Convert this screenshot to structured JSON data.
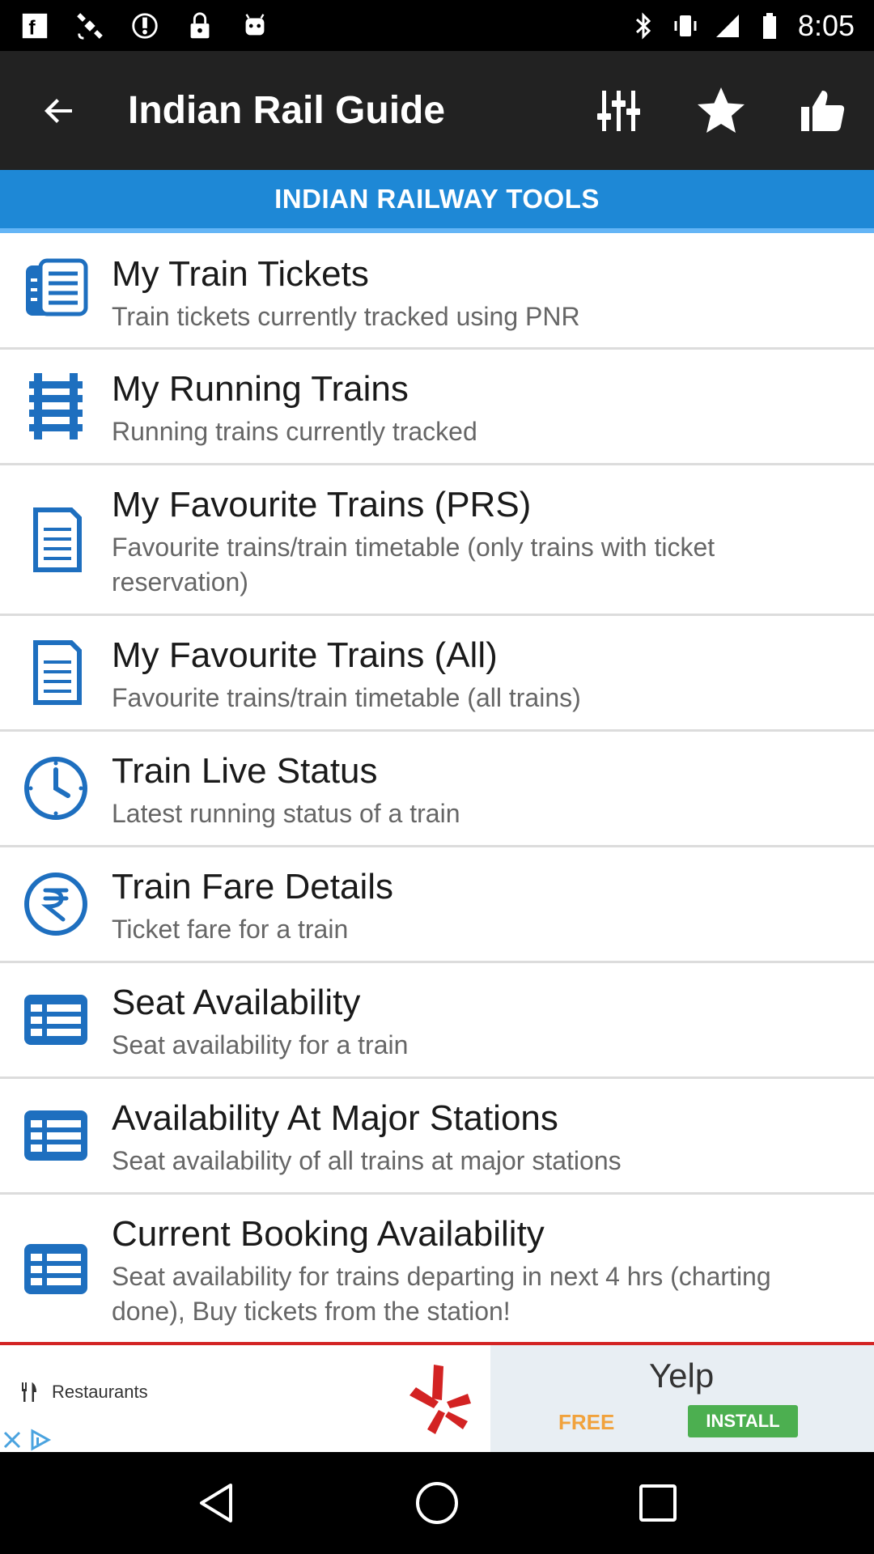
{
  "status_bar": {
    "time": "8:05",
    "left_icons": [
      "notification-f-icon",
      "satellite-icon",
      "alarm-icon",
      "lock-icon",
      "android-icon"
    ],
    "right_icons": [
      "bluetooth-icon",
      "vibrate-icon",
      "signal-icon",
      "battery-icon"
    ]
  },
  "app_bar": {
    "title": "Indian Rail Guide",
    "actions": [
      "sliders-icon",
      "star-icon",
      "thumbs-up-icon"
    ]
  },
  "section": {
    "title": "INDIAN RAILWAY TOOLS"
  },
  "items": [
    {
      "title": "My Train Tickets",
      "subtitle": "Train tickets currently tracked using PNR",
      "icon": "tickets-icon"
    },
    {
      "title": "My Running Trains",
      "subtitle": "Running trains currently tracked",
      "icon": "railway-track-icon"
    },
    {
      "title": "My Favourite Trains (PRS)",
      "subtitle": "Favourite trains/train timetable (only trains with ticket reservation)",
      "icon": "document-icon"
    },
    {
      "title": "My Favourite Trains (All)",
      "subtitle": "Favourite trains/train timetable (all trains)",
      "icon": "document-icon"
    },
    {
      "title": "Train Live Status",
      "subtitle": "Latest running status of a train",
      "icon": "clock-icon"
    },
    {
      "title": "Train Fare Details",
      "subtitle": "Ticket fare for a train",
      "icon": "rupee-icon"
    },
    {
      "title": "Seat Availability",
      "subtitle": "Seat availability for a train",
      "icon": "table-icon"
    },
    {
      "title": "Availability At Major Stations",
      "subtitle": "Seat availability of all trains at major stations",
      "icon": "table-icon"
    },
    {
      "title": "Current Booking Availability",
      "subtitle": "Seat availability for trains departing in next 4 hrs (charting done), Buy tickets from the station!",
      "icon": "table-icon"
    }
  ],
  "ad": {
    "category": "Restaurants",
    "brand": "Yelp",
    "free_label": "FREE",
    "install_label": "INSTALL"
  },
  "colors": {
    "app_bar": "#222222",
    "section_bar": "#1e88d6",
    "icon_blue": "#1e6fbf",
    "ad_red": "#d32323",
    "install_green": "#4caf50"
  }
}
